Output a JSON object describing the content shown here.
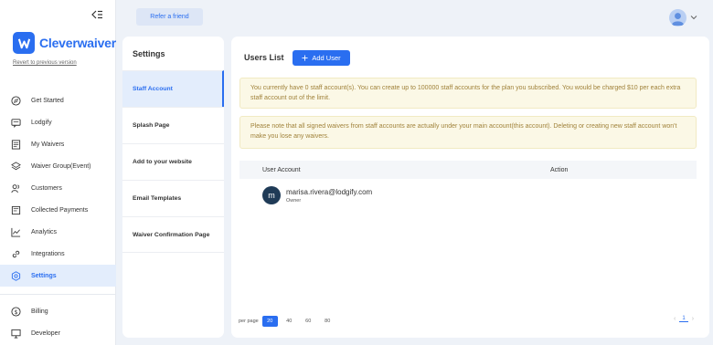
{
  "brand": {
    "name": "Cleverwaiver",
    "revert_label": "Revert to previous version",
    "accent": "#2a6ef0"
  },
  "topbar": {
    "refer_label": "Refer a friend"
  },
  "nav": [
    {
      "label": "Get Started",
      "icon": "compass-icon"
    },
    {
      "label": "Lodgify",
      "icon": "message-icon"
    },
    {
      "label": "My Waivers",
      "icon": "document-icon"
    },
    {
      "label": "Waiver Group(Event)",
      "icon": "layers-icon"
    },
    {
      "label": "Customers",
      "icon": "users-icon"
    },
    {
      "label": "Collected Payments",
      "icon": "receipt-icon"
    },
    {
      "label": "Analytics",
      "icon": "chart-icon"
    },
    {
      "label": "Integrations",
      "icon": "link-icon"
    },
    {
      "label": "Settings",
      "icon": "gear-icon",
      "active": true
    }
  ],
  "nav_bottom": [
    {
      "label": "Billing",
      "icon": "dollar-icon"
    },
    {
      "label": "Developer",
      "icon": "monitor-icon"
    }
  ],
  "settings": {
    "title": "Settings",
    "items": [
      "Staff Account",
      "Splash Page",
      "Add to your website",
      "Email Templates",
      "Waiver Confirmation Page"
    ]
  },
  "users": {
    "title": "Users List",
    "add_label": "Add User",
    "notice1": "You currently have 0 staff account(s). You can create up to 100000 staff accounts for the plan you subscribed. You would be charged $10 per each extra staff account out of the limit.",
    "notice2": "Please note that all signed waivers from staff accounts are actually under your main account(this account). Deleting or creating new staff account won't make you lose any waivers.",
    "col_user": "User Account",
    "col_action": "Action",
    "rows": [
      {
        "initial": "m",
        "email": "marisa.rivera@lodgify.com",
        "role": "Owner"
      }
    ]
  },
  "pagination": {
    "per_page_label": "per page",
    "sizes": [
      "20",
      "40",
      "60",
      "80"
    ],
    "selected": "20",
    "current_page": "1"
  }
}
